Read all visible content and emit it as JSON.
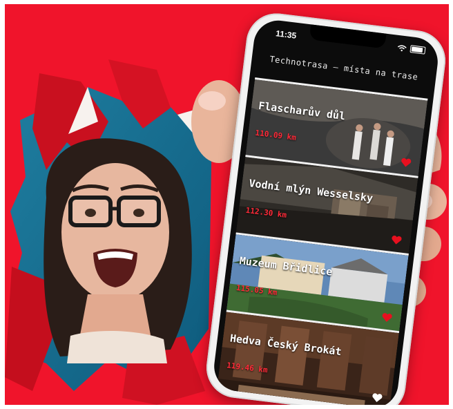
{
  "phone": {
    "status_time": "11:35",
    "header_title": "Technotrasa – místa na trase"
  },
  "places": [
    {
      "name": "Flascharův důl",
      "distance": "110.09 km",
      "favorite_color": "#e8101f"
    },
    {
      "name": "Vodní mlýn Wesselsky",
      "distance": "112.30 km",
      "favorite_color": "#e8101f"
    },
    {
      "name": "Muzeum Břidlice",
      "distance": "115.05 km",
      "favorite_color": "#e8101f"
    },
    {
      "name": "Hedva Český Brokát",
      "distance": "119.46 km",
      "favorite_color": "#ffffff"
    }
  ],
  "colors": {
    "background_red": "#f0142b",
    "accent_red": "#e8101f"
  },
  "icons": [
    "wifi-icon",
    "battery-icon",
    "heart-icon"
  ]
}
